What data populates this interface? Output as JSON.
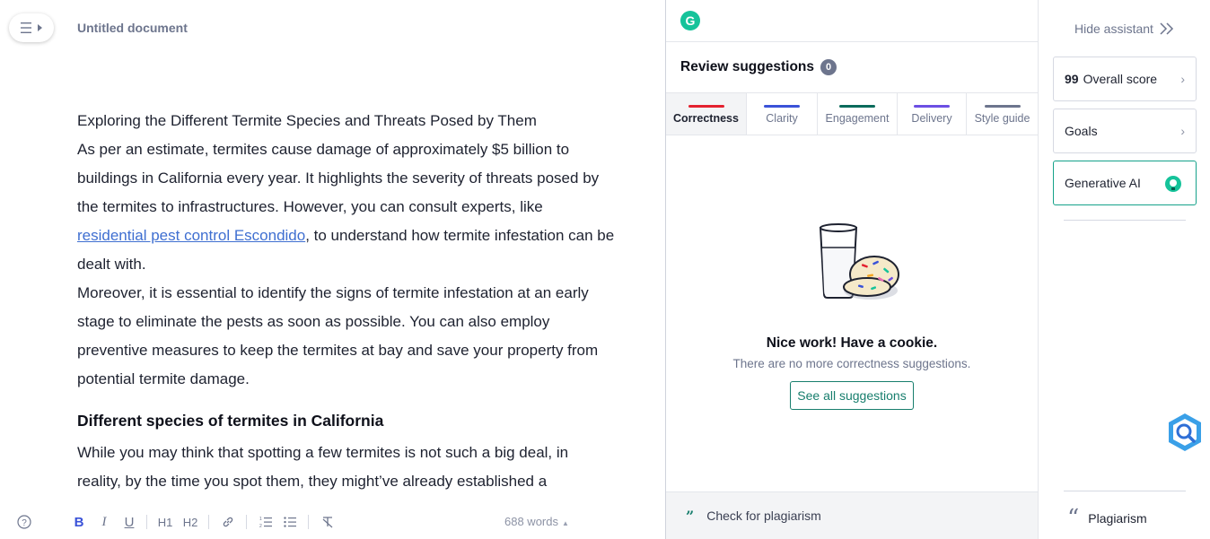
{
  "editor": {
    "doc_title": "Untitled document",
    "menu_icon": "hamburger-menu-icon",
    "paragraphs": [
      "Exploring the Different Termite Species and Threats Posed by Them",
      "As per an estimate, termites cause damage of approximately $5 billion to buildings in California every year. It highlights the severity of threats posed by the termites to infrastructures. However, you can consult experts, like ",
      ", to understand how termite infestation can be dealt with.",
      "Moreover, it is essential to identify the signs of termite infestation at an early stage to eliminate the pests as soon as possible. You can also employ preventive measures to keep the termites at bay and save your property from potential termite damage.",
      "While you may think that spotting a few termites is not such a big deal, in reality, by the time you spot them, they might’ve already established a"
    ],
    "link_text": "residential pest control Escondido",
    "heading": "Different species of termites in California",
    "toolbar": {
      "help": "?",
      "bold": "B",
      "italic": "I",
      "underline": "U",
      "h1": "H1",
      "h2": "H2",
      "link_icon": "link-icon",
      "ordered_list_icon": "ordered-list-icon",
      "bullet_list_icon": "bullet-list-icon",
      "clear_format_icon": "clear-format-icon",
      "word_count": "688 words",
      "word_count_caret": "▲"
    }
  },
  "panel": {
    "logo_letter": "G",
    "title": "Review suggestions",
    "count": "0",
    "tabs": [
      {
        "label": "Correctness",
        "color": "#e4212f",
        "active": true
      },
      {
        "label": "Clarity",
        "color": "#3a52d8",
        "active": false
      },
      {
        "label": "Engagement",
        "color": "#0b6b5c",
        "active": false
      },
      {
        "label": "Delivery",
        "color": "#6c4fe3",
        "active": false
      },
      {
        "label": "Style guide",
        "color": "#6d758d",
        "active": false
      }
    ],
    "empty_title": "Nice work! Have a cookie.",
    "empty_subtitle": "There are no more correctness suggestions.",
    "see_all": "See all suggestions",
    "plagiarism_label": "Check for plagiarism"
  },
  "sidebar": {
    "hide_assistant": "Hide assistant",
    "overall_score_value": "99",
    "overall_score_label": "Overall score",
    "goals": "Goals",
    "generative_ai": "Generative AI",
    "plagiarism": "Plagiarism"
  },
  "colors": {
    "brand_green": "#15c39a",
    "accent_teal": "#177e6d",
    "link_blue": "#3f6fd1"
  }
}
